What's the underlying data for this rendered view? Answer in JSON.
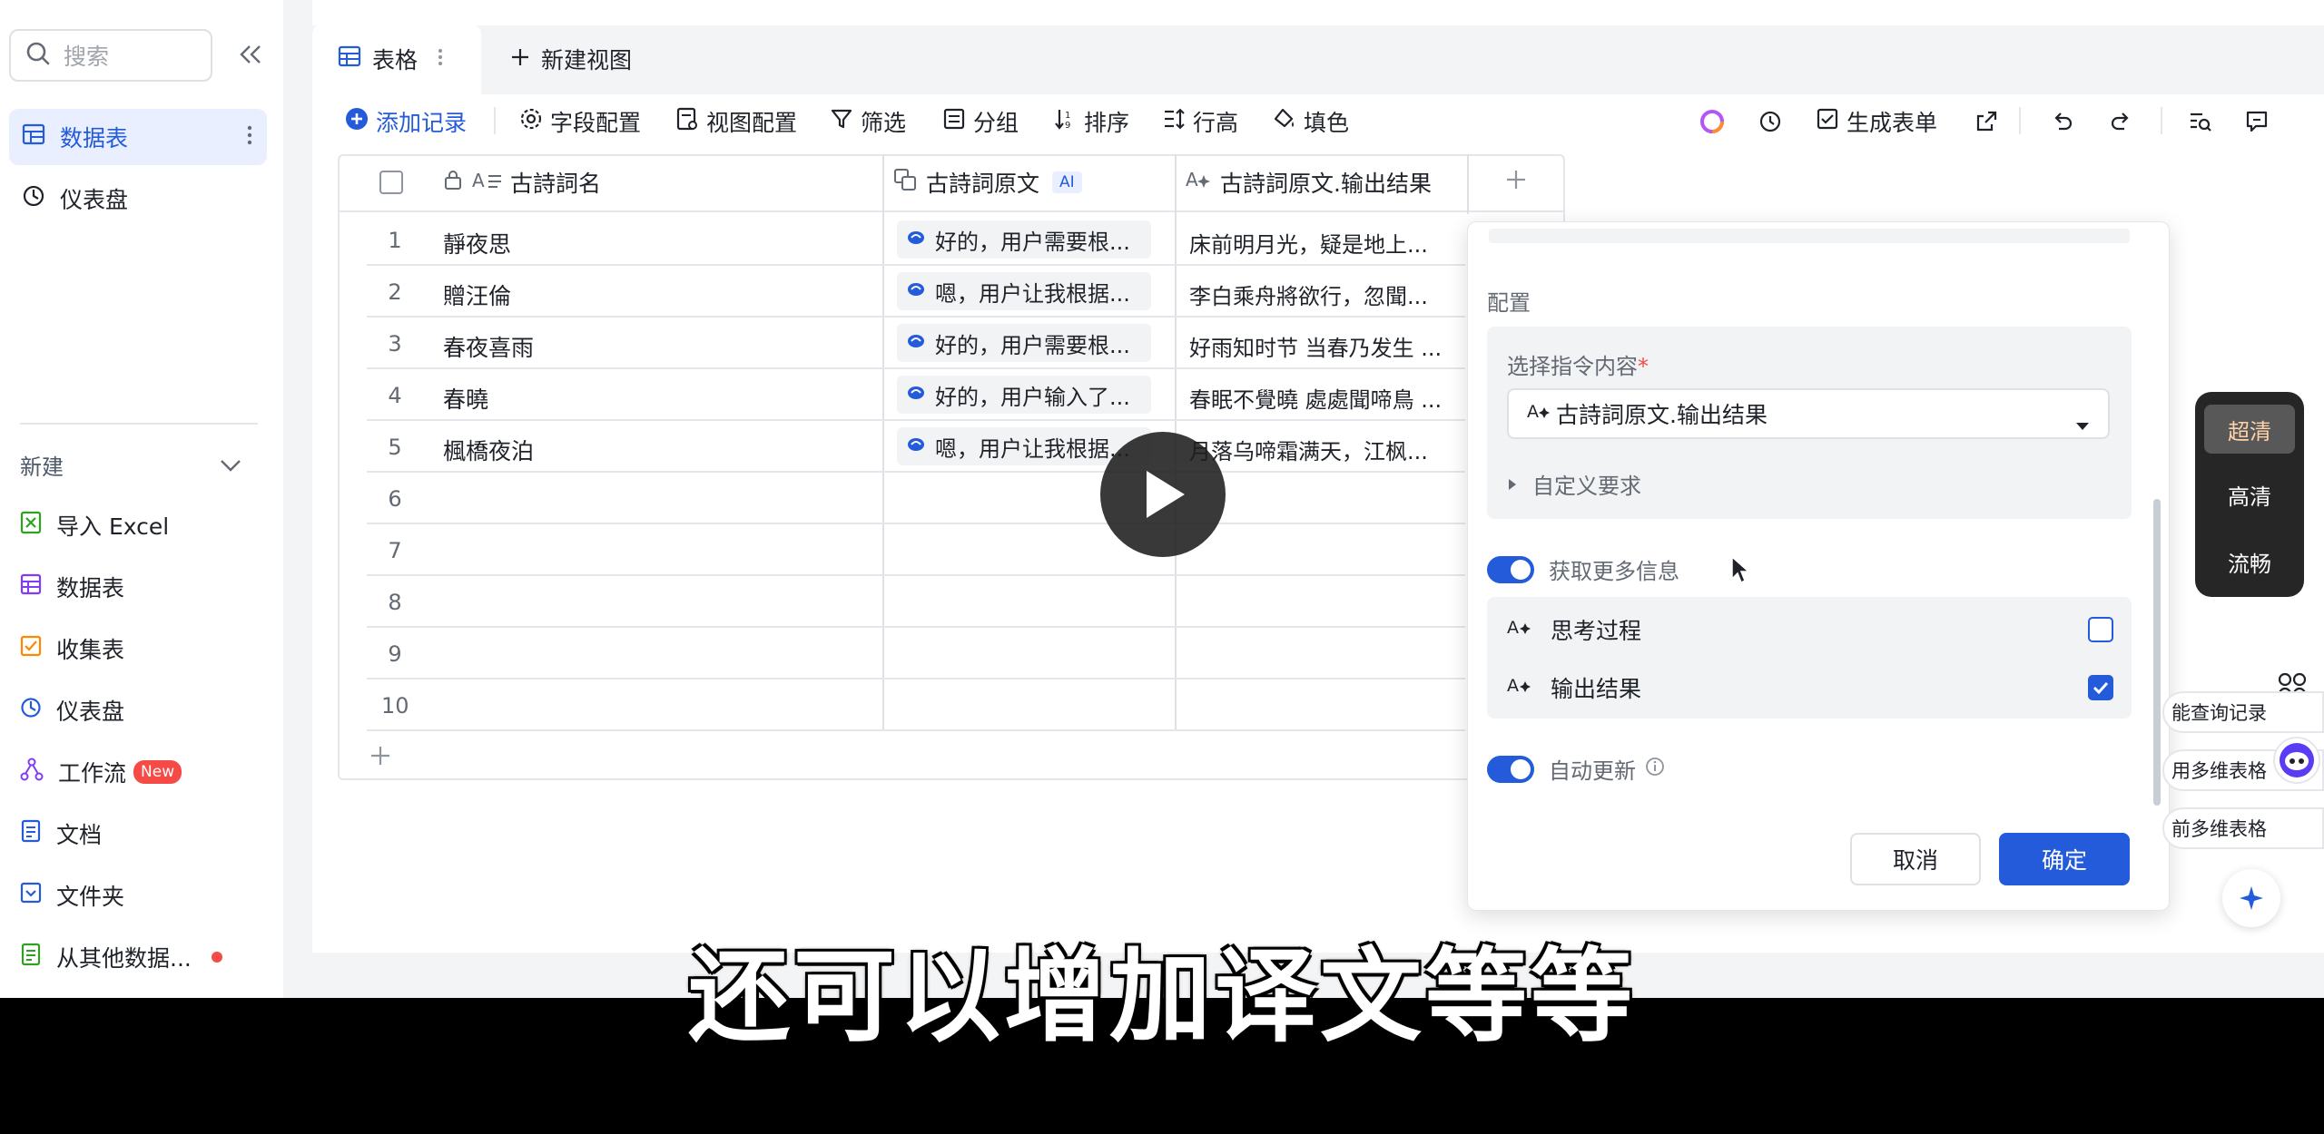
{
  "sidebar": {
    "search_placeholder": "搜索",
    "items": [
      {
        "label": "数据表",
        "active": true
      },
      {
        "label": "仪表盘",
        "active": false
      }
    ],
    "new_header": "新建",
    "new_items": [
      {
        "label": "导入 Excel"
      },
      {
        "label": "数据表"
      },
      {
        "label": "收集表"
      },
      {
        "label": "仪表盘"
      },
      {
        "label": "工作流",
        "badge": "New"
      },
      {
        "label": "文档"
      },
      {
        "label": "文件夹"
      },
      {
        "label": "从其他数据..."
      }
    ]
  },
  "tabs": {
    "active": "表格",
    "new_view": "新建视图"
  },
  "toolbar": {
    "add_record": "添加记录",
    "field_config": "字段配置",
    "view_config": "视图配置",
    "filter": "筛选",
    "group": "分组",
    "sort": "排序",
    "row_height": "行高",
    "fill": "填色",
    "generate_form": "生成表单"
  },
  "grid": {
    "columns": [
      {
        "label": "古詩詞名"
      },
      {
        "label": "古詩詞原文",
        "tag": "AI"
      },
      {
        "label": "古詩詞原文.输出结果"
      }
    ],
    "rows": [
      {
        "n": "1",
        "name": "靜夜思",
        "ai": "好的，用户需要根...",
        "result": "床前明月光，疑是地上..."
      },
      {
        "n": "2",
        "name": "贈汪倫",
        "ai": "嗯，用户让我根据...",
        "result": "李白乘舟將欲行，忽聞..."
      },
      {
        "n": "3",
        "name": "春夜喜雨",
        "ai": "好的，用户需要根...",
        "result": "好雨知时节 当春乃发生 ..."
      },
      {
        "n": "4",
        "name": "春曉",
        "ai": "好的，用户输入了...",
        "result": "春眠不覺曉 處處聞啼鳥 ..."
      },
      {
        "n": "5",
        "name": "楓橋夜泊",
        "ai": "嗯，用户让我根据...",
        "result": "月落乌啼霜满天，江枫..."
      },
      {
        "n": "6",
        "name": "",
        "ai": "",
        "result": ""
      },
      {
        "n": "7",
        "name": "",
        "ai": "",
        "result": ""
      },
      {
        "n": "8",
        "name": "",
        "ai": "",
        "result": ""
      },
      {
        "n": "9",
        "name": "",
        "ai": "",
        "result": ""
      },
      {
        "n": "10",
        "name": "",
        "ai": "",
        "result": ""
      }
    ],
    "add_row": "+"
  },
  "panel": {
    "section_title": "配置",
    "select_label": "选择指令内容",
    "required_mark": "*",
    "select_value": "古詩詞原文.输出结果",
    "custom_req": "自定义要求",
    "more_info_label": "获取更多信息",
    "options": [
      {
        "label": "思考过程",
        "checked": false
      },
      {
        "label": "输出结果",
        "checked": true
      }
    ],
    "auto_update": "自动更新",
    "cancel": "取消",
    "confirm": "确定"
  },
  "quality": {
    "options": [
      "超清",
      "高清",
      "流畅"
    ],
    "selected": "超清"
  },
  "side_pills": [
    "能查询记录",
    "用多维表格",
    "前多维表格"
  ],
  "subtitle": "还可以增加译文等等",
  "colors": {
    "accent": "#245bdb",
    "sidebar_active_bg": "#e9effe",
    "badge_red": "#f54a45"
  }
}
